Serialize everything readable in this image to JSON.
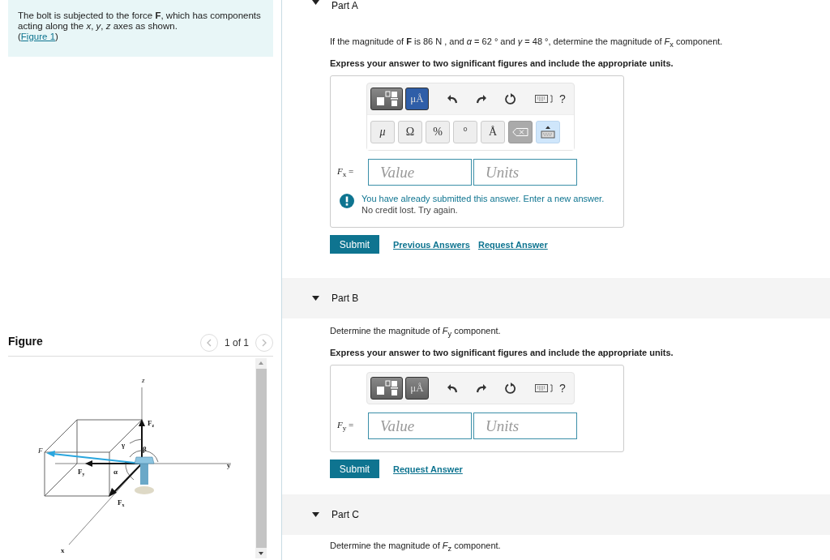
{
  "problem": {
    "text": "The bolt is subjected to the force **F**, which has components acting along the *x*, *y*, *z* axes as shown.",
    "figure_ref": {
      "before": "(",
      "link": "Figure 1",
      "after": ")"
    }
  },
  "figure": {
    "title": "Figure",
    "pager": "1 of 1",
    "labels": [
      {
        "main": "z"
      },
      {
        "main": "F",
        "sub": "z"
      },
      {
        "main": "F"
      },
      {
        "main": "γ"
      },
      {
        "main": "β"
      },
      {
        "main": "F",
        "sub": "y"
      },
      {
        "main": "y"
      },
      {
        "main": "α"
      },
      {
        "main": "F",
        "sub": "x"
      },
      {
        "main": "x"
      }
    ]
  },
  "parts": [
    {
      "title": "Part A",
      "expanded": true,
      "question": "If the magnitude of **F** is 86 N , and *α* = 62 ° and *γ* = 48 °, determine the magnitude of *F*$_{x}$ component.",
      "instruction": "Express your answer to two significant figures and include the appropriate units.",
      "toolbar": {
        "units_label": "μÅ",
        "units_selected": true,
        "help": "?",
        "keys": [
          "μ",
          "Ω",
          "%",
          "°",
          "Å"
        ]
      },
      "answer_label": "*F*$_{x}$ =",
      "value_placeholder": "Value",
      "units_placeholder": "Units",
      "feedback": {
        "message": "You have already submitted this answer. Enter a new answer.",
        "note": "No credit lost. Try again."
      },
      "buttons": [
        {
          "label": "Submit",
          "kind": "primary"
        },
        {
          "label": "Previous Answers",
          "kind": "link"
        },
        {
          "label": "Request Answer",
          "kind": "link"
        }
      ]
    },
    {
      "title": "Part B",
      "expanded": true,
      "question": "Determine the magnitude of *F*$_{y}$ component.",
      "instruction": "Express your answer to two significant figures and include the appropriate units.",
      "toolbar": {
        "units_label": "μÅ",
        "units_selected": false,
        "help": "?"
      },
      "answer_label": "*F*$_{y}$ =",
      "value_placeholder": "Value",
      "units_placeholder": "Units",
      "buttons": [
        {
          "label": "Submit",
          "kind": "primary"
        },
        {
          "label": "Request Answer",
          "kind": "link"
        }
      ]
    },
    {
      "title": "Part C",
      "expanded": true,
      "question": "Determine the magnitude of *F*$_{z}$ component."
    }
  ]
}
